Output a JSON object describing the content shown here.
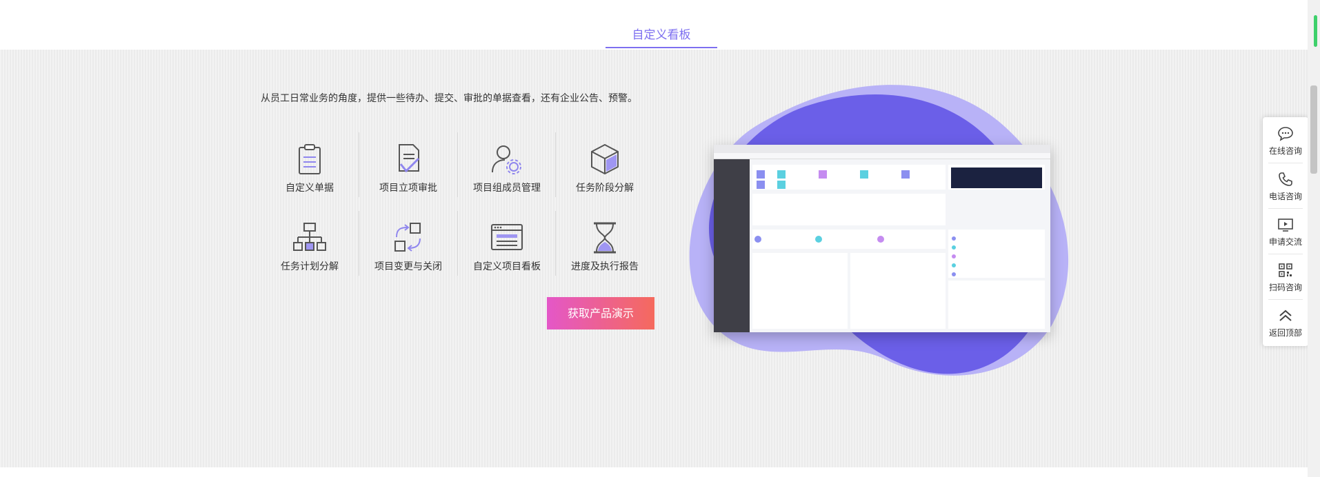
{
  "header": {
    "active_tab": "自定义看板"
  },
  "intro": "从员工日常业务的角度，提供一些待办、提交、审批的单据查看，还有企业公告、预警。",
  "features": [
    {
      "label": "自定义单据",
      "icon": "clipboard-icon"
    },
    {
      "label": "项目立项审批",
      "icon": "document-check-icon"
    },
    {
      "label": "项目组成员管理",
      "icon": "user-gear-icon"
    },
    {
      "label": "任务阶段分解",
      "icon": "cube-icon"
    },
    {
      "label": "任务计划分解",
      "icon": "org-chart-icon"
    },
    {
      "label": "项目变更与关闭",
      "icon": "change-arrows-icon"
    },
    {
      "label": "自定义项目看板",
      "icon": "dashboard-window-icon"
    },
    {
      "label": "进度及执行报告",
      "icon": "hourglass-icon"
    }
  ],
  "cta": {
    "label": "获取产品演示"
  },
  "float_panel": [
    {
      "label": "在线咨询",
      "icon": "chat-bubble-icon"
    },
    {
      "label": "电话咨询",
      "icon": "phone-icon"
    },
    {
      "label": "申请交流",
      "icon": "play-screen-icon"
    },
    {
      "label": "扫码咨询",
      "icon": "qr-code-icon"
    },
    {
      "label": "返回顶部",
      "icon": "double-chevron-up-icon"
    }
  ],
  "colors": {
    "accent": "#7d6ff0",
    "blob_dark": "#6a5ee8",
    "blob_light": "#b6b0f7",
    "cta_start": "#e457c8",
    "cta_end": "#f56a5d"
  }
}
